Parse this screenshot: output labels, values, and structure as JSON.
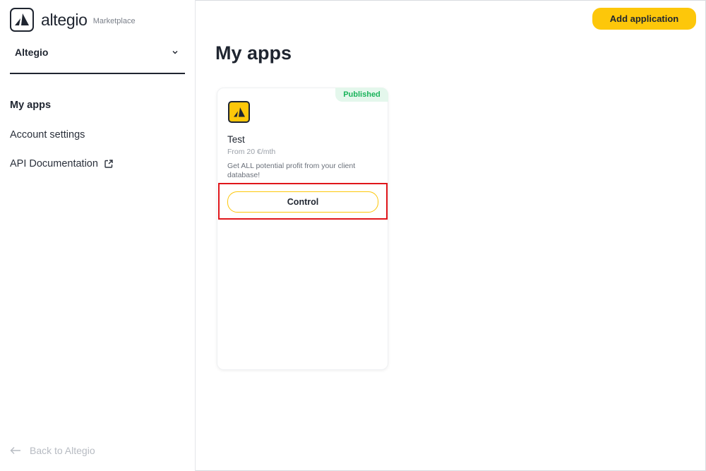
{
  "sidebar": {
    "logo_text": "altegio",
    "logo_subtitle": "Marketplace",
    "company": "Altegio",
    "nav": [
      {
        "label": "My apps"
      },
      {
        "label": "Account settings"
      },
      {
        "label": "API Documentation"
      }
    ],
    "back_label": "Back to Altegio"
  },
  "header": {
    "add_button_label": "Add application"
  },
  "main": {
    "title": "My apps",
    "apps": [
      {
        "status": "Published",
        "name": "Test",
        "price": "From 20 €/mth",
        "description": "Get ALL potential profit from your client database!",
        "action_label": "Control"
      }
    ]
  },
  "colors": {
    "accent": "#fdc70a",
    "text": "#1f2530",
    "published": "#19b35a",
    "highlight": "#e0161b"
  },
  "icons": {
    "logo": "altegio-logo-icon",
    "chevron": "chevron-down-icon",
    "external": "external-link-icon",
    "back": "arrow-left-icon"
  }
}
